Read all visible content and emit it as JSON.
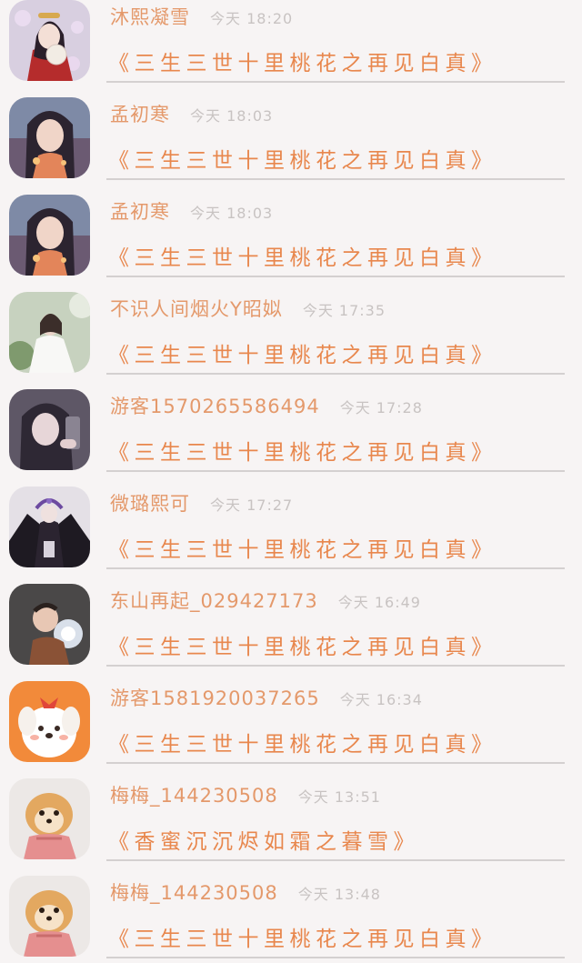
{
  "comments": [
    {
      "name": "沐熙凝雪",
      "time": "今天 18:20",
      "book": "《三生三世十里桃花之再见白真》",
      "avatar": "avatar-hanfu-girl"
    },
    {
      "name": "孟初寒",
      "time": "今天 18:03",
      "book": "《三生三世十里桃花之再见白真》",
      "avatar": "avatar-dark-hair-girl"
    },
    {
      "name": "孟初寒",
      "time": "今天 18:03",
      "book": "《三生三世十里桃花之再见白真》",
      "avatar": "avatar-dark-hair-girl"
    },
    {
      "name": "不识人间烟火Y昭姒",
      "time": "今天 17:35",
      "book": "《三生三世十里桃花之再见白真》",
      "avatar": "avatar-white-dress-girl"
    },
    {
      "name": "游客1570265586494",
      "time": "今天 17:28",
      "book": "《三生三世十里桃花之再见白真》",
      "avatar": "avatar-selfie-girl"
    },
    {
      "name": "微璐熙可",
      "time": "今天 17:27",
      "book": "《三生三世十里桃花之再见白真》",
      "avatar": "avatar-gothic-figure"
    },
    {
      "name": "东山再起_029427173",
      "time": "今天 16:49",
      "book": "《三生三世十里桃花之再见白真》",
      "avatar": "avatar-baby-photo"
    },
    {
      "name": "游客1581920037265",
      "time": "今天 16:34",
      "book": "《三生三世十里桃花之再见白真》",
      "avatar": "avatar-cartoon-dog"
    },
    {
      "name": "梅梅_144230508",
      "time": "今天 13:51",
      "book": "《香蜜沉沉烬如霜之暮雪》",
      "avatar": "avatar-pomeranian"
    },
    {
      "name": "梅梅_144230508",
      "time": "今天 13:48",
      "book": "《三生三世十里桃花之再见白真》",
      "avatar": "avatar-pomeranian"
    }
  ]
}
